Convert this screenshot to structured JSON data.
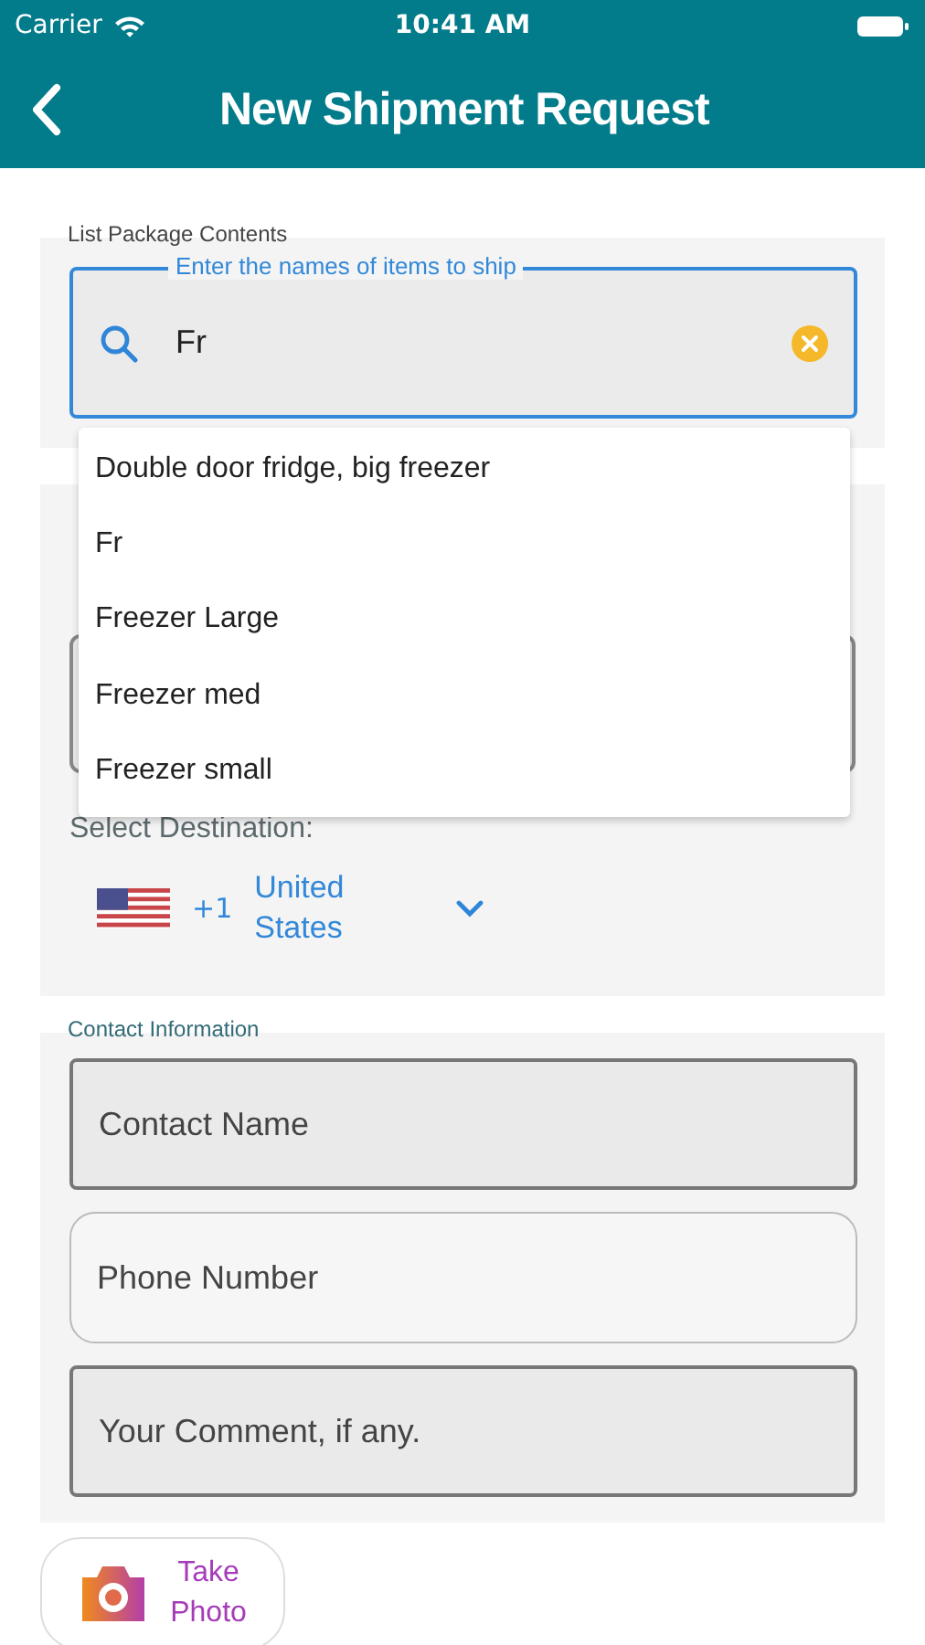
{
  "status_bar": {
    "carrier": "Carrier",
    "time": "10:41 AM"
  },
  "nav": {
    "title": "New Shipment Request"
  },
  "contents": {
    "label": "List Package Contents",
    "field": {
      "legend": "Enter the names of items to ship",
      "value": "Fr"
    },
    "suggestions": [
      "Double door fridge, big freezer",
      "Fr",
      "Freezer Large",
      "Freezer med",
      "Freezer small"
    ]
  },
  "destination": {
    "select_label": "Select Destination:",
    "dial_code": "+1",
    "country": "United States"
  },
  "contact": {
    "label": "Contact Information",
    "fields": [
      {
        "placeholder": "Contact Name",
        "kind": "filled"
      },
      {
        "placeholder": "Phone Number",
        "kind": "outlined"
      },
      {
        "placeholder": "Your Comment, if any.",
        "kind": "filled"
      }
    ]
  },
  "take_photo": {
    "label": "Take Photo"
  }
}
